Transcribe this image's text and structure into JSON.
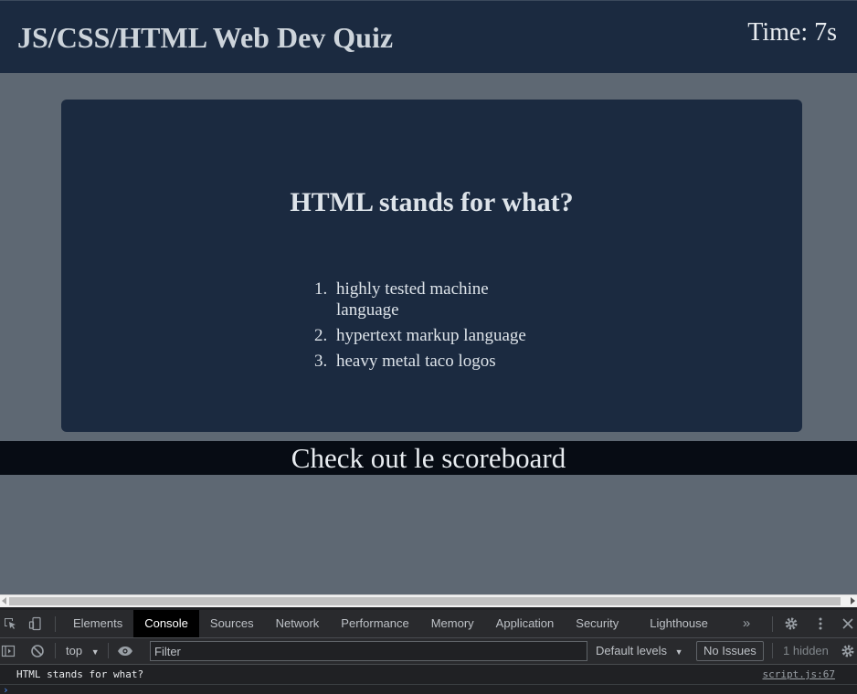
{
  "page": {
    "title": "JS/CSS/HTML Web Dev Quiz",
    "timer": "Time: 7s"
  },
  "quiz": {
    "question": "HTML stands for what?",
    "choices": [
      {
        "number": "1.",
        "label": "highly tested machine language"
      },
      {
        "number": "2.",
        "label": "hypertext markup language"
      },
      {
        "number": "3.",
        "label": "heavy metal taco logos"
      }
    ]
  },
  "scoreboard": {
    "label": "Check out le scoreboard"
  },
  "devtools": {
    "tabs": [
      "Elements",
      "Console",
      "Sources",
      "Network",
      "Performance",
      "Memory",
      "Application",
      "Security",
      "Lighthouse"
    ],
    "active_tab": "Console",
    "more_tabs_glyph": "»",
    "toolbar": {
      "context": "top",
      "filter_placeholder": "Filter",
      "levels": "Default levels",
      "issues": "No Issues",
      "hidden": "1 hidden"
    },
    "console_log": {
      "message": "HTML stands for what?",
      "source": "script.js:67"
    }
  },
  "colors": {
    "header_bg": "#1b2a40",
    "page_bg": "#5e6873",
    "scoreboard_bg": "#070c14",
    "devtools_bg": "#202124"
  },
  "icons": {
    "inspect": "inspect-element-icon",
    "device": "device-toolbar-icon",
    "settings": "gear-icon",
    "menu": "kebab-menu-icon",
    "close": "close-icon",
    "sidebar": "console-sidebar-icon",
    "clear": "clear-console-icon",
    "live": "eye-icon"
  }
}
